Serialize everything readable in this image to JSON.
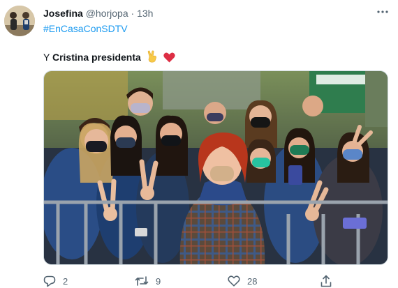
{
  "tweet": {
    "author_name": "Josefina",
    "handle": "@horjopa",
    "separator": "·",
    "time": "13h",
    "hashtag": "#EnCasaConSDTV",
    "text_prefix": "Y",
    "text_bold": "Cristina presidenta"
  },
  "actions": {
    "reply_count": "2",
    "retweet_count": "9",
    "like_count": "28"
  },
  "colors": {
    "link": "#1d9bf0",
    "muted": "#536471",
    "heart_emoji": "#e0245e"
  }
}
